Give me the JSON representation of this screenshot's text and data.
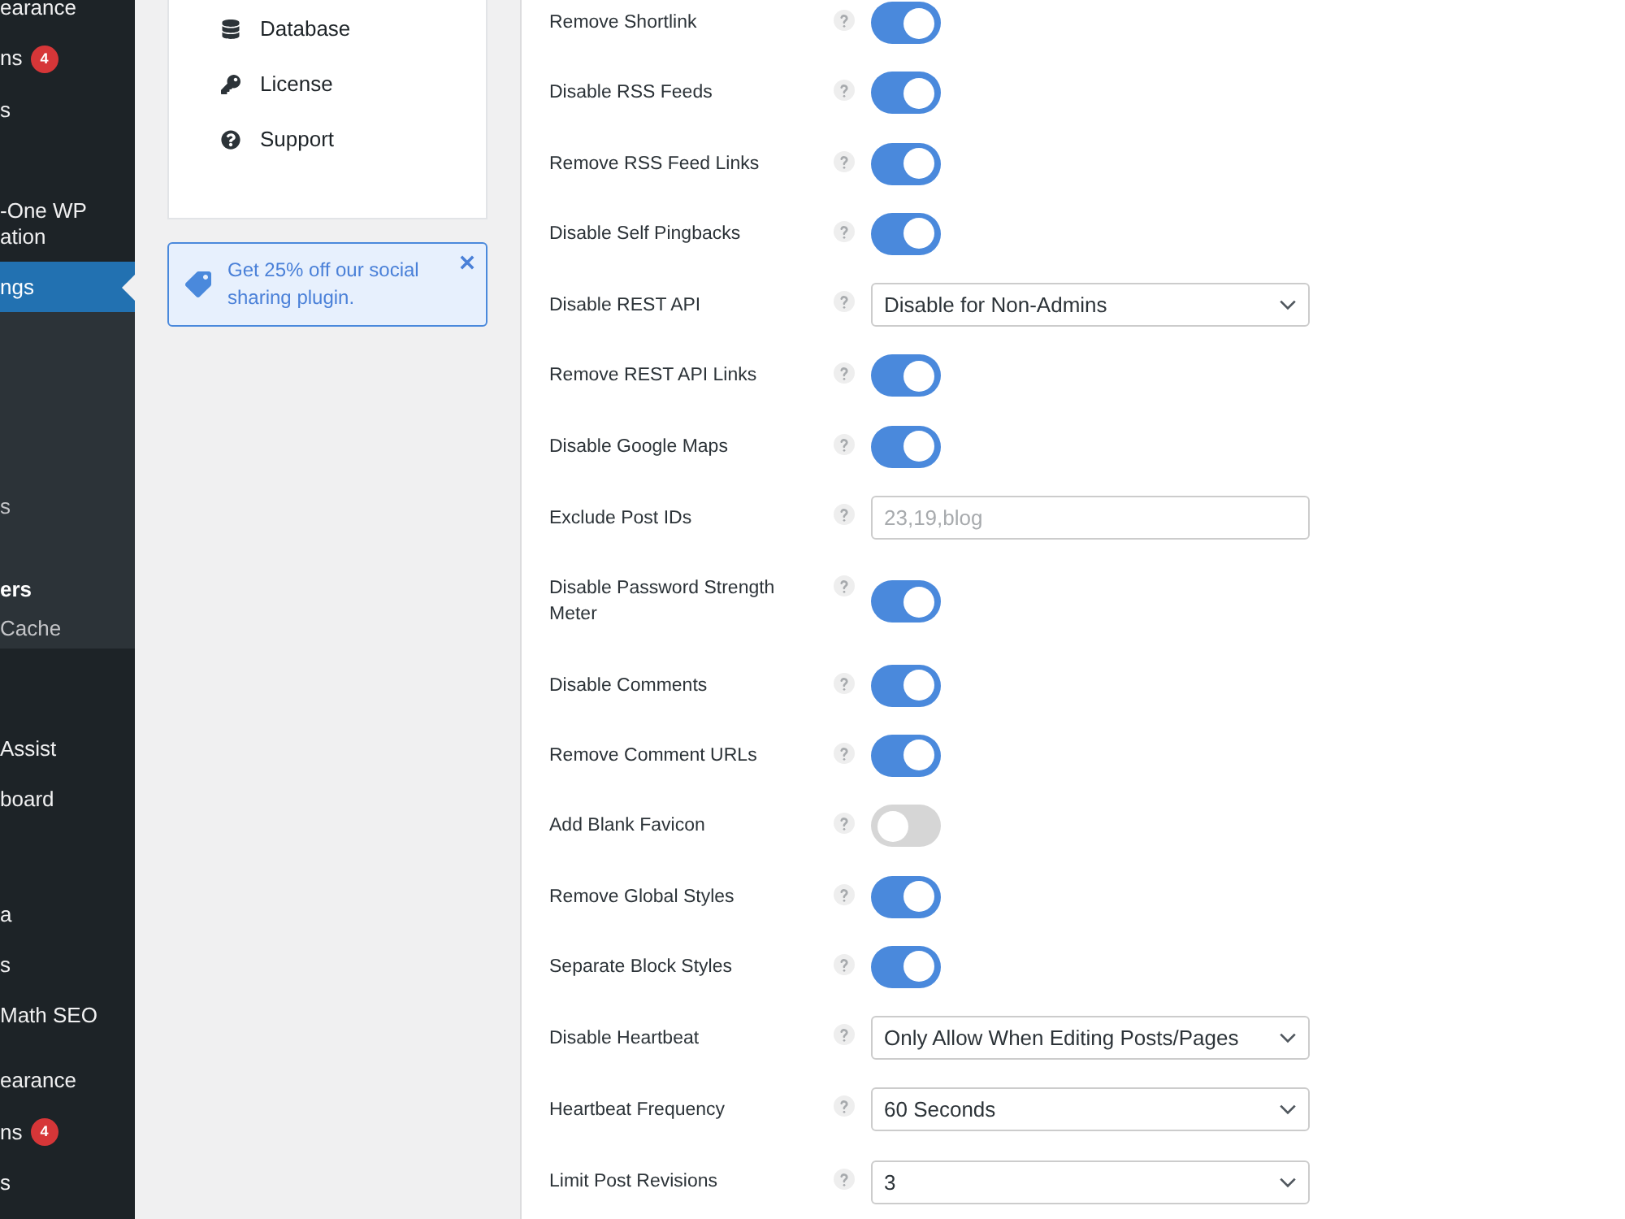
{
  "sidebar": {
    "top_items": [
      {
        "label": "earance",
        "selected": false
      },
      {
        "label": "ns",
        "badge": "4",
        "selected": false
      },
      {
        "label": "s",
        "selected": false
      },
      {
        "label": "-One WP ation",
        "selected": false
      },
      {
        "label": "ngs",
        "selected": true
      }
    ],
    "submenu": [
      {
        "label": "s",
        "selected": false
      },
      {
        "label": "ers",
        "selected": true
      },
      {
        "label": "Cache",
        "selected": false
      }
    ],
    "lower_items": [
      {
        "label": "Assist",
        "selected": false
      },
      {
        "label": "board",
        "selected": false
      },
      {
        "label": "a",
        "selected": false
      },
      {
        "label": "s",
        "selected": false
      },
      {
        "label": "Math SEO",
        "selected": false
      },
      {
        "label": "earance",
        "selected": false
      },
      {
        "label": "ns",
        "badge": "4",
        "selected": false
      },
      {
        "label": "s",
        "selected": false
      }
    ]
  },
  "settings_menu": [
    {
      "label": "Database"
    },
    {
      "label": "License"
    },
    {
      "label": "Support"
    }
  ],
  "promo": {
    "text": "Get 25% off our social sharing plugin."
  },
  "settings": [
    {
      "label": "Remove Shortlink",
      "kind": "toggle",
      "on": true
    },
    {
      "label": "Disable RSS Feeds",
      "kind": "toggle",
      "on": true
    },
    {
      "label": "Remove RSS Feed Links",
      "kind": "toggle",
      "on": true
    },
    {
      "label": "Disable Self Pingbacks",
      "kind": "toggle",
      "on": true
    },
    {
      "label": "Disable REST API",
      "kind": "select",
      "value": "Disable for Non-Admins"
    },
    {
      "label": "Remove REST API Links",
      "kind": "toggle",
      "on": true
    },
    {
      "label": "Disable Google Maps",
      "kind": "toggle",
      "on": true
    },
    {
      "label": "Exclude Post IDs",
      "kind": "input",
      "placeholder": "23,19,blog"
    },
    {
      "label": "Disable Password Strength Meter",
      "kind": "toggle",
      "on": true
    },
    {
      "label": "Disable Comments",
      "kind": "toggle",
      "on": true
    },
    {
      "label": "Remove Comment URLs",
      "kind": "toggle",
      "on": true
    },
    {
      "label": "Add Blank Favicon",
      "kind": "toggle",
      "on": false
    },
    {
      "label": "Remove Global Styles",
      "kind": "toggle",
      "on": true
    },
    {
      "label": "Separate Block Styles",
      "kind": "toggle",
      "on": true
    },
    {
      "label": "Disable Heartbeat",
      "kind": "select",
      "value": "Only Allow When Editing Posts/Pages"
    },
    {
      "label": "Heartbeat Frequency",
      "kind": "select",
      "value": "60 Seconds"
    },
    {
      "label": "Limit Post Revisions",
      "kind": "select",
      "value": "3"
    }
  ]
}
